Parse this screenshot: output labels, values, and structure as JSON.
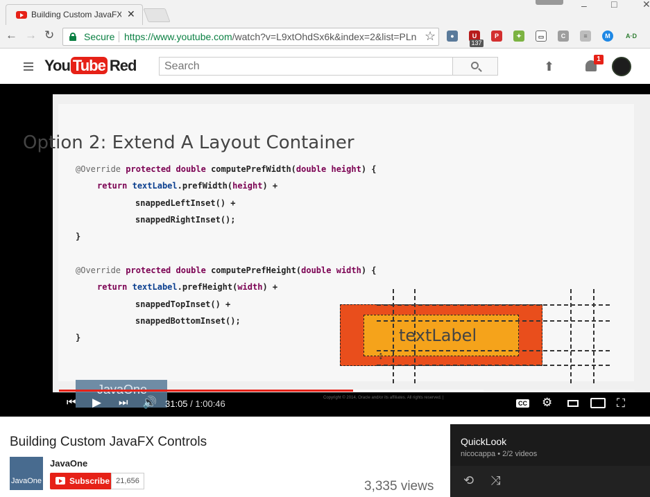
{
  "browser": {
    "tab_title": "Building Custom JavaFX Controls",
    "tab_close": "✕",
    "secure_label": "Secure",
    "url_host": "https://www.youtube.com",
    "url_rest": "/watch?v=L9xtOhdSx6k&index=2&list=PLn",
    "ext_badge_count": "137"
  },
  "youtube": {
    "logo_you": "You",
    "logo_tube": "Tube",
    "logo_red": "Red",
    "search_placeholder": "Search",
    "notification_count": "1"
  },
  "slide": {
    "title": "Option 2: Extend A Layout Container",
    "box_label": "textLabel",
    "watermark": "JavaOne",
    "copyright": "Copyright © 2014, Oracle and/or its affiliates. All rights reserved. |"
  },
  "player": {
    "current_time": "31:05",
    "separator": " / ",
    "duration": "1:00:46",
    "played_fraction": 0.511,
    "buffered_fraction": 0.737
  },
  "video": {
    "title": "Building Custom JavaFX Controls",
    "channel": "JavaOne",
    "channel_avatar_text": "JavaOne",
    "subscribe_label": "Subscribe",
    "subscriber_count": "21,656",
    "views": "3,335 views"
  },
  "playlist": {
    "title": "QuickLook",
    "meta": "nicocappa • 2/2 videos"
  }
}
